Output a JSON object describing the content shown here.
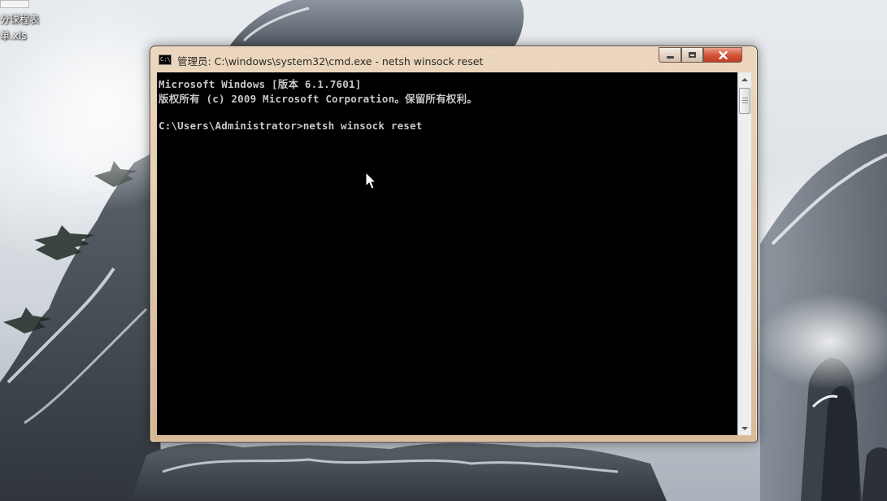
{
  "desktop": {
    "icons": [
      {
        "label": "分课程表"
      },
      {
        "label": "单.xls"
      }
    ]
  },
  "window": {
    "title": "管理员: C:\\windows\\system32\\cmd.exe - netsh  winsock reset",
    "icon": "cmd-icon",
    "icon_text": "C:\\",
    "buttons": {
      "minimize": "minimize-icon",
      "maximize": "maximize-icon",
      "close": "close-icon"
    }
  },
  "console": {
    "lines": [
      "Microsoft Windows [版本 6.1.7601]",
      "版权所有 (c) 2009 Microsoft Corporation。保留所有权利。",
      "",
      "C:\\Users\\Administrator>netsh winsock reset"
    ],
    "text_color": "#c8c8c8",
    "background": "#000000"
  },
  "cursor": {
    "icon": "mouse-pointer-icon"
  }
}
